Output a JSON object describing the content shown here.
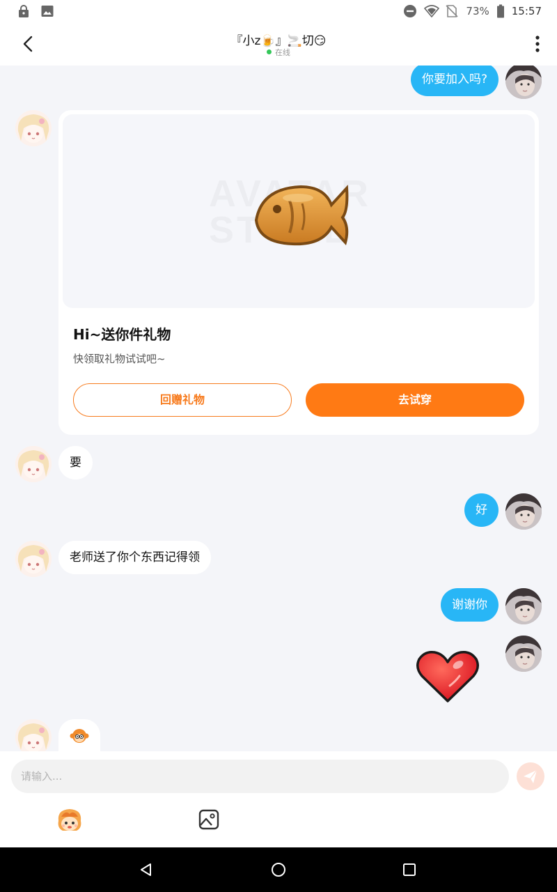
{
  "status_bar": {
    "battery": "73%",
    "time": "15:57"
  },
  "header": {
    "title": "『小z🍺』🚬切😏",
    "status": "在线"
  },
  "messages": {
    "m1": "你要加入吗?",
    "gift": {
      "title": "Hi~送你件礼物",
      "subtitle": "快领取礼物试试吧~",
      "return_label": "回赠礼物",
      "try_label": "去试穿",
      "watermark": "AVATAR STORE"
    },
    "m2": "要",
    "m3": "好",
    "m4": "老师送了你个东西记得领",
    "m5": "谢谢你"
  },
  "input": {
    "placeholder": "请输入..."
  },
  "colors": {
    "accent_orange": "#ff7a14",
    "my_bubble": "#28b6f6",
    "background": "#f4f5f9",
    "online_dot": "#34c759"
  },
  "icons": [
    "lock-icon",
    "image-notification-icon",
    "do-not-disturb-icon",
    "wifi-icon",
    "no-sim-icon",
    "battery-icon",
    "back-arrow-icon",
    "more-vert-icon",
    "fish-cookie-gift-icon",
    "heart-sticker-icon",
    "send-icon",
    "emoji-face-icon",
    "image-picker-icon",
    "nav-back-icon",
    "nav-home-icon",
    "nav-recents-icon"
  ]
}
